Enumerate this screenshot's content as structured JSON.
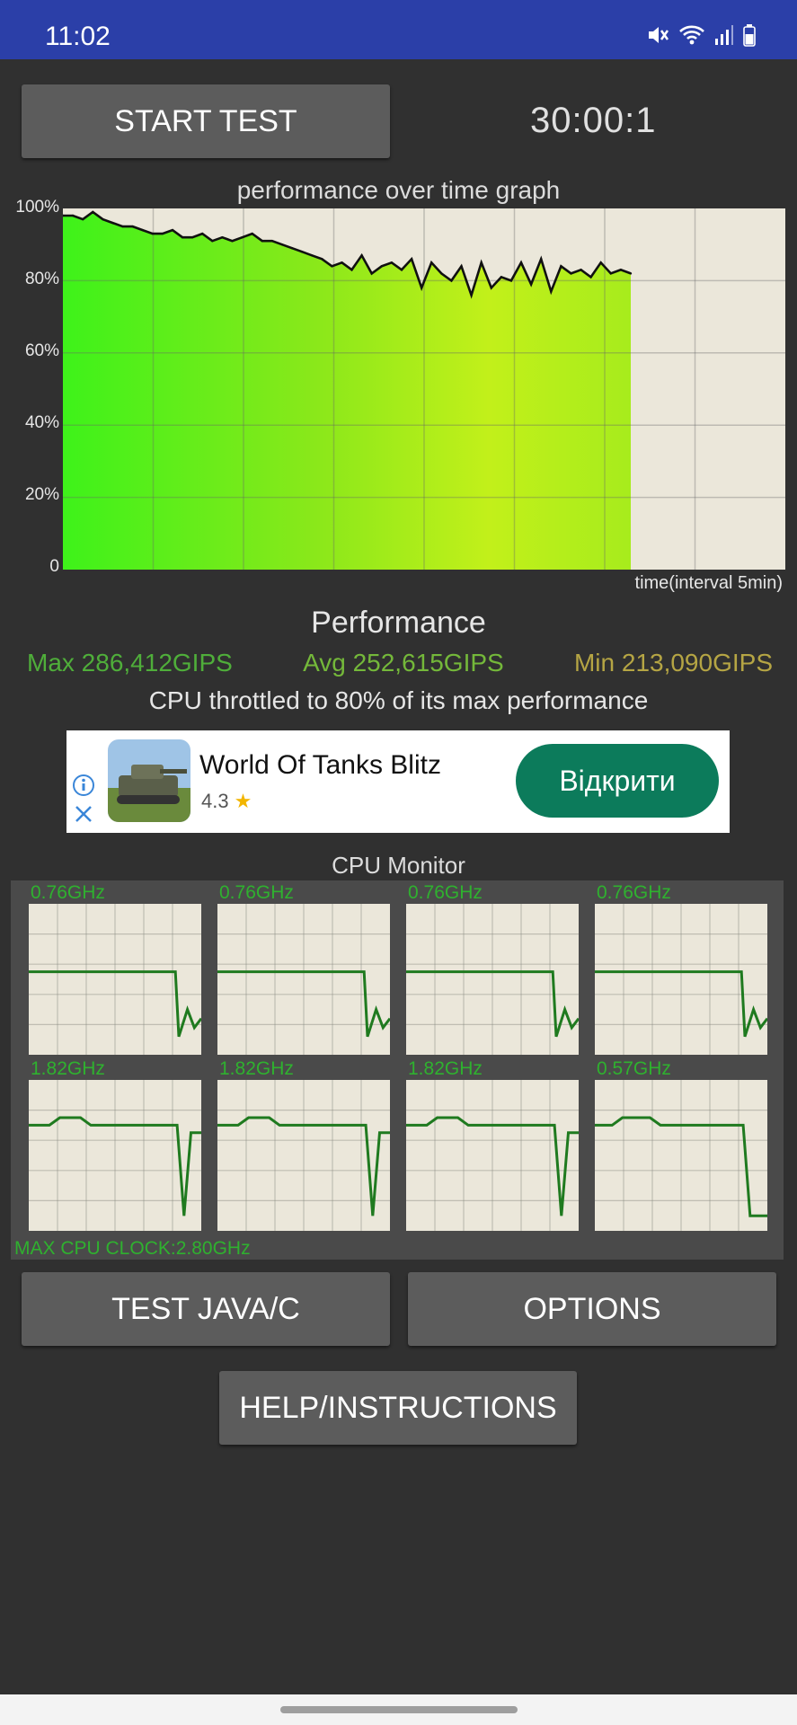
{
  "status_bar": {
    "time": "11:02"
  },
  "start_button": "START TEST",
  "timer": "30:00:1",
  "graph": {
    "title": "performance over time graph",
    "y_labels": [
      "100%",
      "80%",
      "60%",
      "40%",
      "20%",
      "0"
    ],
    "x_label": "time(interval 5min)"
  },
  "chart_data": {
    "type": "area",
    "title": "performance over time graph",
    "xlabel": "time(interval 5min)",
    "ylabel": "",
    "ylim": [
      0,
      100
    ],
    "y_ticks": [
      "100%",
      "80%",
      "60%",
      "40%",
      "20%",
      "0"
    ],
    "grid": true,
    "series": [
      {
        "values": [
          98,
          98,
          97,
          99,
          97,
          96,
          95,
          95,
          94,
          93,
          93,
          94,
          92,
          92,
          93,
          91,
          92,
          91,
          92,
          93,
          91,
          91,
          90,
          89,
          88,
          87,
          86,
          84,
          85,
          83,
          87,
          82,
          84,
          85,
          83,
          86,
          78,
          85,
          82,
          80,
          84,
          76,
          85,
          78,
          81,
          80,
          85,
          79,
          86,
          77,
          84,
          82,
          83,
          81,
          85,
          82,
          83,
          82
        ]
      }
    ]
  },
  "performance": {
    "title": "Performance",
    "max": "Max 286,412GIPS",
    "avg": "Avg 252,615GIPS",
    "min": "Min 213,090GIPS",
    "throttle_note": "CPU throttled to 80% of its max performance",
    "colors": {
      "max": "#4fae3a",
      "avg": "#74b83a",
      "min": "#b5a544"
    }
  },
  "ad": {
    "app_name": "World Of Tanks Blitz",
    "rating": "4.3",
    "cta": "Відкрити",
    "icons": [
      "info-icon",
      "close-icon",
      "star-icon"
    ]
  },
  "cpu_monitor": {
    "title": "CPU Monitor",
    "cores": [
      {
        "label": "0.76GHz"
      },
      {
        "label": "0.76GHz"
      },
      {
        "label": "0.76GHz"
      },
      {
        "label": "0.76GHz"
      },
      {
        "label": "1.82GHz"
      },
      {
        "label": "1.82GHz"
      },
      {
        "label": "1.82GHz"
      },
      {
        "label": "0.57GHz"
      }
    ],
    "max_clock": "MAX CPU CLOCK:2.80GHz"
  },
  "buttons": {
    "test_java_c": "TEST JAVA/C",
    "options": "OPTIONS",
    "help": "HELP/INSTRUCTIONS"
  }
}
